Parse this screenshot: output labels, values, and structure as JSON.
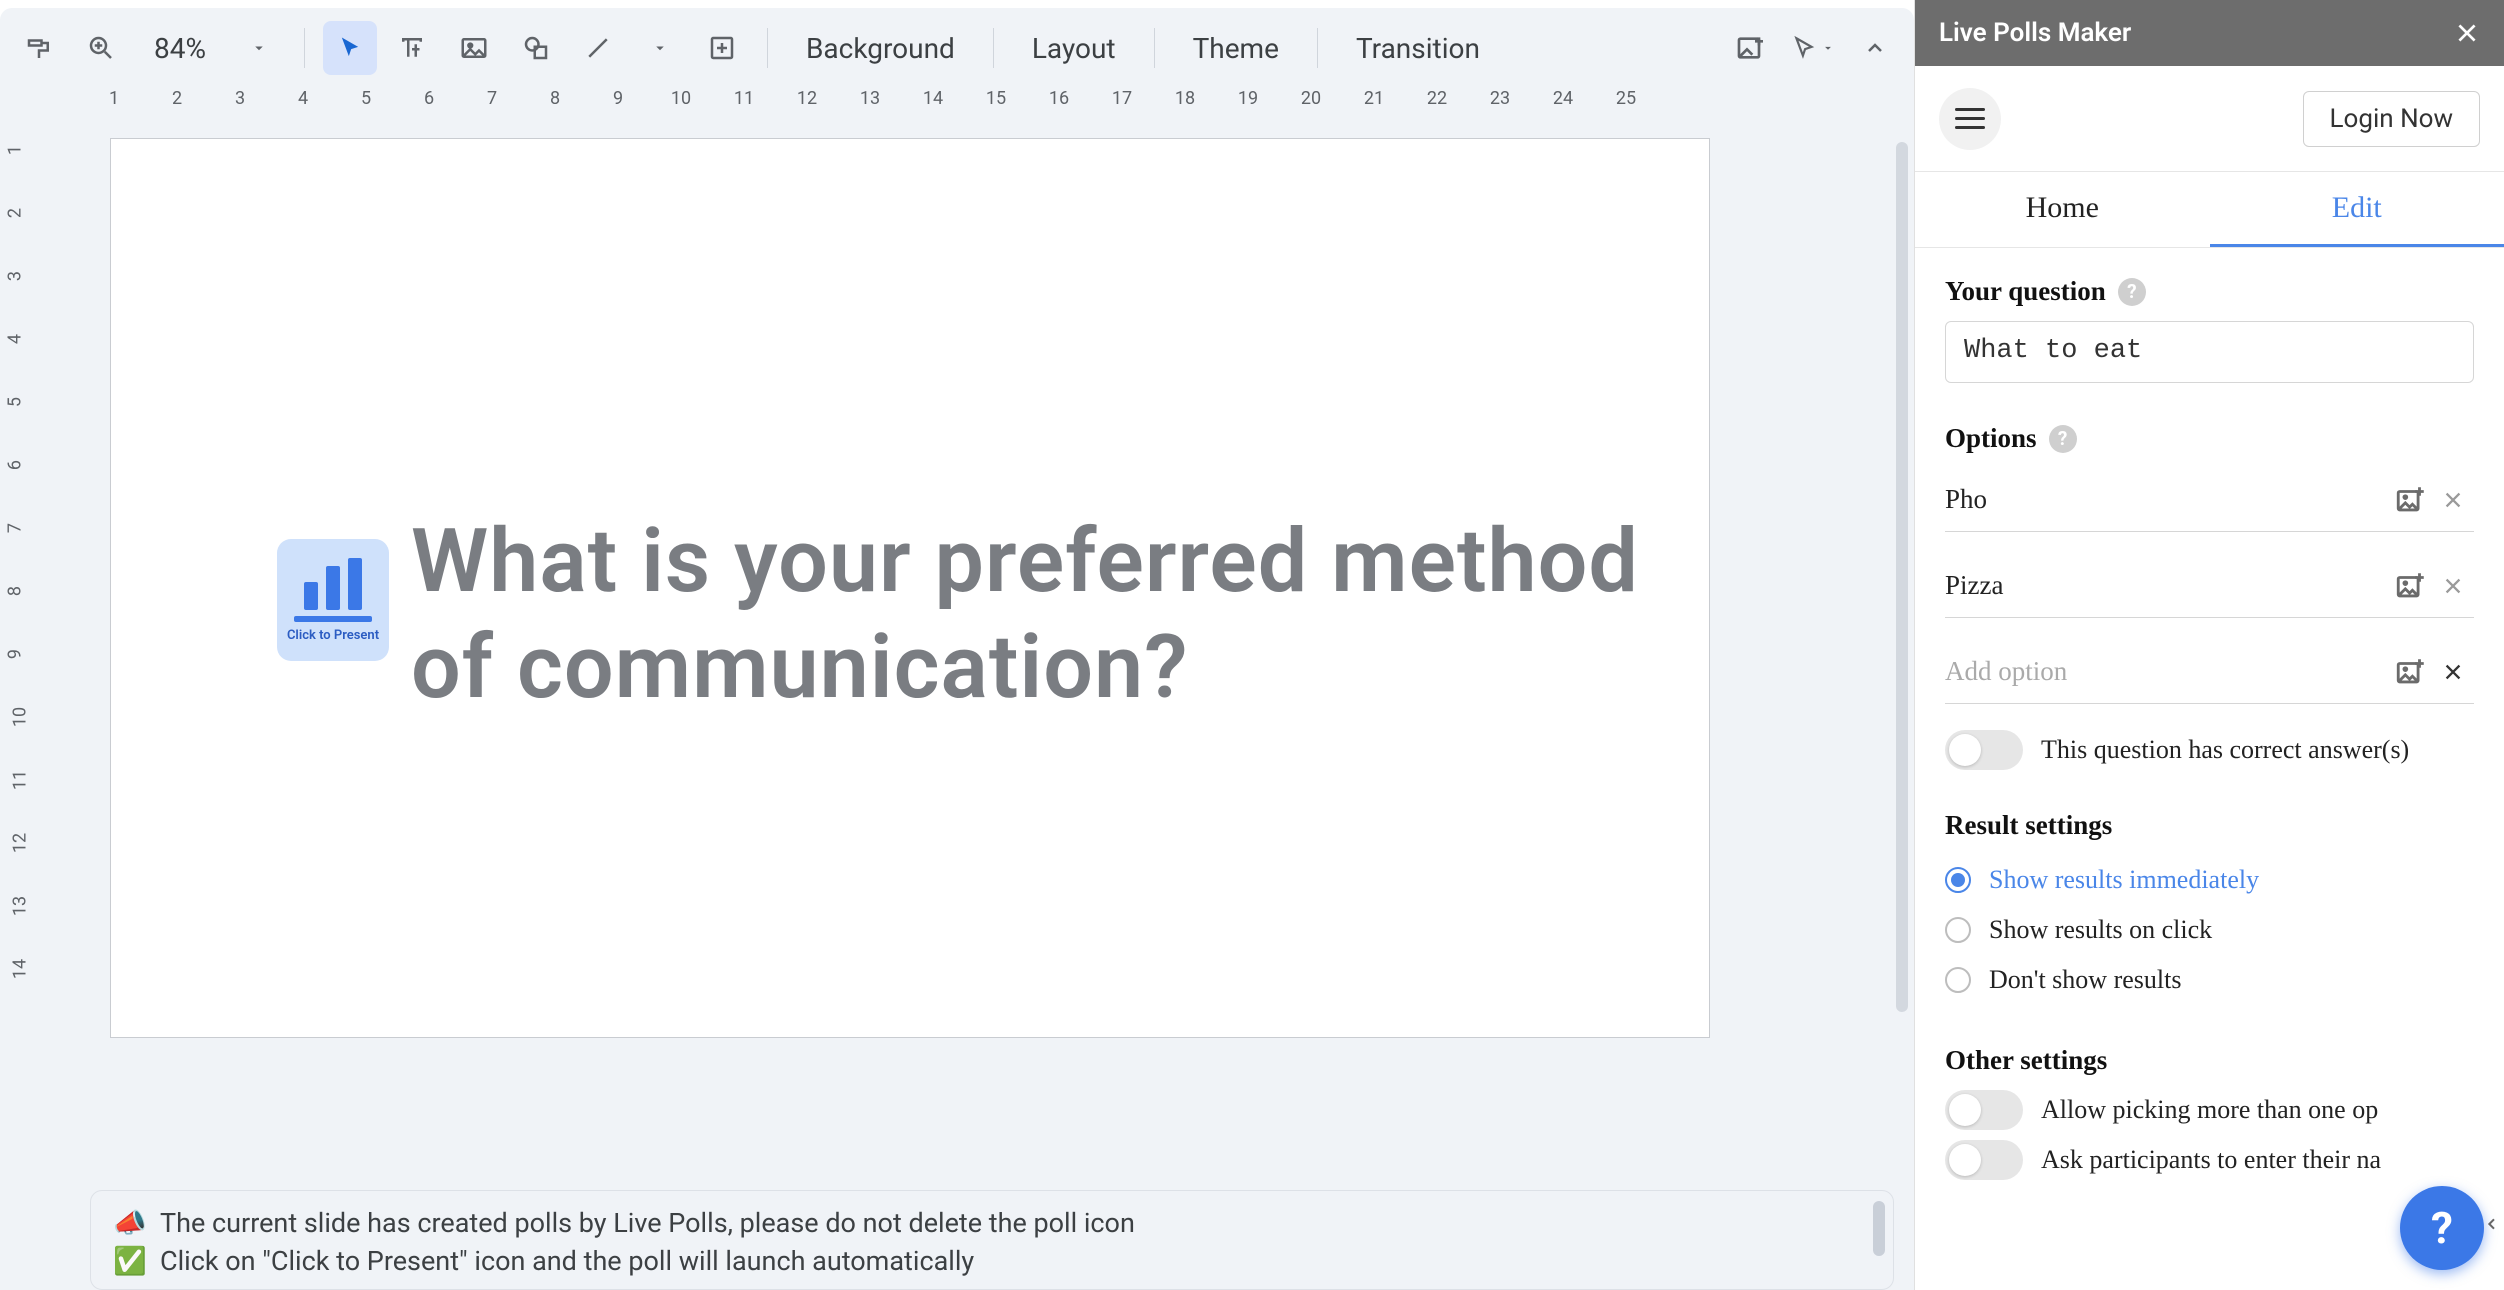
{
  "toolbar": {
    "zoom": "84%",
    "background": "Background",
    "layout": "Layout",
    "theme": "Theme",
    "transition": "Transition"
  },
  "ruler_h": [
    "1",
    "2",
    "3",
    "4",
    "5",
    "6",
    "7",
    "8",
    "9",
    "10",
    "11",
    "12",
    "13",
    "14",
    "15",
    "16",
    "17",
    "18",
    "19",
    "20",
    "21",
    "22",
    "23",
    "24",
    "25"
  ],
  "ruler_v": [
    "1",
    "2",
    "3",
    "4",
    "5",
    "6",
    "7",
    "8",
    "9",
    "10",
    "11",
    "12",
    "13",
    "14"
  ],
  "slide": {
    "poll_icon_label": "Click to Present",
    "title": "What is your preferred method of communication?"
  },
  "notes": {
    "line1_emoji": "📣",
    "line1": "The current slide has created polls by Live Polls, please do not delete the poll icon",
    "line2_emoji": "✅",
    "line2": "Click on \"Click to Present\" icon and the poll will launch automatically"
  },
  "sidebar": {
    "title": "Live Polls Maker",
    "login": "Login Now",
    "tabs": {
      "home": "Home",
      "edit": "Edit"
    },
    "question_label": "Your question",
    "question_value": "What to eat",
    "options_label": "Options",
    "options": [
      "Pho",
      "Pizza"
    ],
    "add_option_placeholder": "Add option",
    "correct_answer_label": "This question has correct answer(s)",
    "result_settings_label": "Result settings",
    "result_options": {
      "immediate": "Show results immediately",
      "on_click": "Show results on click",
      "dont_show": "Don't show results"
    },
    "other_settings_label": "Other settings",
    "other": {
      "multi": "Allow picking more than one op",
      "names": "Ask participants to enter their na"
    }
  }
}
